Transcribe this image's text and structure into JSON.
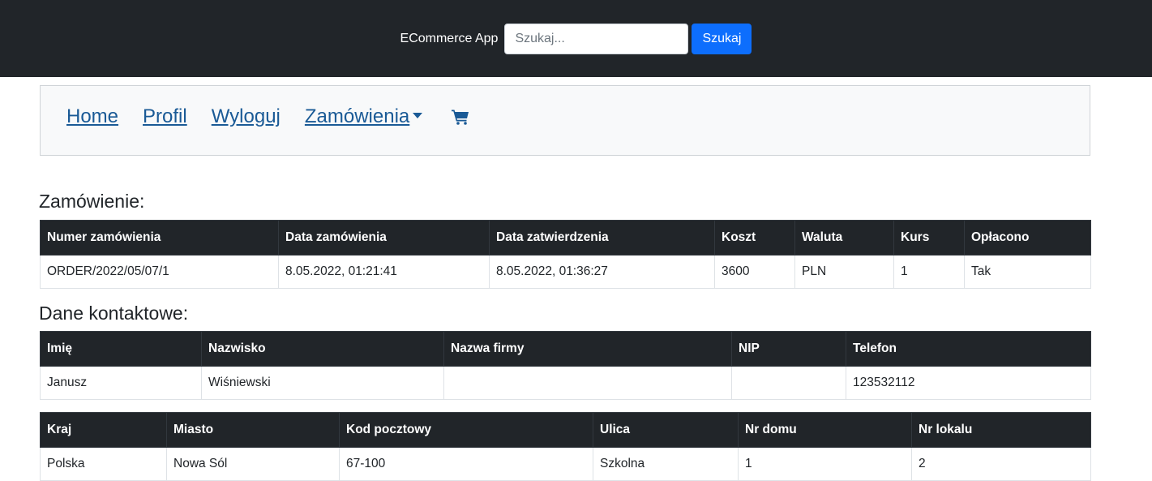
{
  "header": {
    "brand": "ECommerce App",
    "search_placeholder": "Szukaj...",
    "search_button": "Szukaj"
  },
  "nav": {
    "home": "Home",
    "profile": "Profil",
    "logout": "Wyloguj",
    "orders": "Zamówienia",
    "cart_icon": "shopping-cart-icon"
  },
  "order_section": {
    "title": "Zamówienie:",
    "columns": [
      "Numer zamówienia",
      "Data zamówienia",
      "Data zatwierdzenia",
      "Koszt",
      "Waluta",
      "Kurs",
      "Opłacono"
    ],
    "row": [
      "ORDER/2022/05/07/1",
      "8.05.2022, 01:21:41",
      "8.05.2022, 01:36:27",
      "3600",
      "PLN",
      "1",
      "Tak"
    ]
  },
  "contact_section": {
    "title": "Dane kontaktowe:",
    "columns": [
      "Imię",
      "Nazwisko",
      "Nazwa firmy",
      "NIP",
      "Telefon"
    ],
    "row": [
      "Janusz",
      "Wiśniewski",
      "",
      "",
      "123532112"
    ]
  },
  "address_section": {
    "columns": [
      "Kraj",
      "Miasto",
      "Kod pocztowy",
      "Ulica",
      "Nr domu",
      "Nr lokalu"
    ],
    "row": [
      "Polska",
      "Nowa Sól",
      "67-100",
      "Szkolna",
      "1",
      "2"
    ]
  }
}
